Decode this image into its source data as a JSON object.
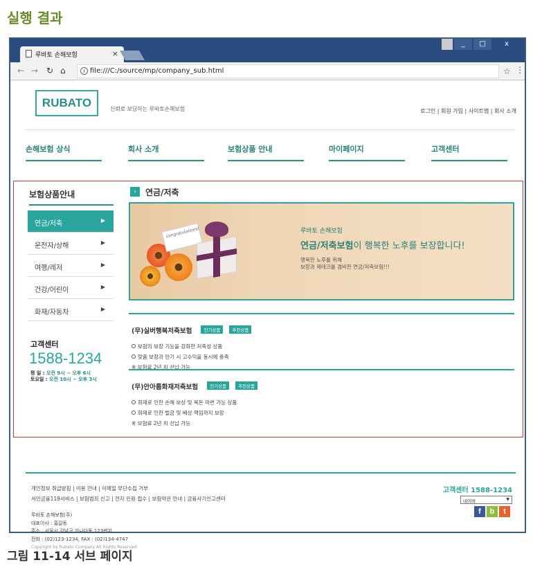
{
  "doc": {
    "heading": "실행 결과",
    "caption": "그림 11-14 서브 페이지"
  },
  "browser": {
    "tab_title": "루바토 손해보험",
    "tab_close": "×",
    "url": "file:///C:/source/mp/company_sub.html",
    "window_buttons": {
      "minimize": "_",
      "maximize": "□",
      "close": "x"
    }
  },
  "header": {
    "logo": "RUBATO",
    "slogan": "신뢰로 보답하는 루바토손해보험",
    "util_links": "로그인 | 회원 가입 | 사이트맵 | 회사 소개"
  },
  "gnb": {
    "items": [
      "손해보험 상식",
      "회사 소개",
      "보험상품 안내",
      "마이페이지",
      "고객센터"
    ]
  },
  "lnb": {
    "title": "보험상품안내",
    "items": [
      "연금/저축",
      "운전자/상해",
      "여행/레저",
      "건강/어린이",
      "화재/자동차"
    ],
    "active_index": 0
  },
  "customer_center": {
    "title": "고객센터",
    "phone": "1588-1234",
    "weekday_label": "평    일 : ",
    "weekday_hours": "오전 9시 ~ 오후 6시",
    "saturday_label": "토요일 : ",
    "saturday_hours": "오전 10시 ~ 오후 3시"
  },
  "section": {
    "title": "연금/저축",
    "icon": "chevron-right-icon"
  },
  "banner": {
    "card_text": "congratulations!",
    "eyebrow": "루바토 손해보험",
    "headline_bold": "연금/저축보험",
    "headline_rest": "이 행복한 노후를 보장합니다!",
    "desc_line1": "행복한 노후를 위해",
    "desc_line2": "보장과 재테크를 겸비한 연금/저축보험!!!"
  },
  "products": [
    {
      "name": "(무)실버행복저축보험",
      "badges": [
        "인기상품",
        "추천상품"
      ],
      "features": [
        "보험의 보장 기능을 강화한 저축성 상품",
        "맞춤 보장과 만기 시 고수익을 동시에 충족"
      ],
      "note": "※ 보험료 2년 치 선납 가능"
    },
    {
      "name": "(무)안아름화재저축보험",
      "badges": [
        "인기상품",
        "추천상품"
      ],
      "features": [
        "화재로 인한 손해 보상 및 목돈 마련 가능 상품",
        "화재로 인한 벌금 및 배상 책임까지 보장"
      ],
      "note": "※ 보험료 2년 치 선납 가능"
    }
  ],
  "footer": {
    "links_line1": "개인정보 취급방침 | 이용 안내 | 이메일 무단수집 거부",
    "links_line2": "서민금융119서비스 | 보험범죄 신고 | 전자 민원 접수 | 보험약관 안내 | 금융사기신고센터",
    "company_name": "루바토 손해보험(주)",
    "ceo": "대표이사 : 홍길동",
    "address": "주소 : 서울시 강남구 가나다동 123번지",
    "contact": "전화 : (02)123-1234, FAX : (02)134-4747",
    "copyright": "Copyright by Rubato Company All Rights Reserved.",
    "cs_text": "고객센터 1588-1234",
    "select_value": "네이버",
    "sns": [
      "f",
      "b",
      "t"
    ]
  },
  "colors": {
    "accent": "#2aa59d",
    "browser_frame": "#2b4c7e",
    "content_border": "#cc3a3a"
  }
}
